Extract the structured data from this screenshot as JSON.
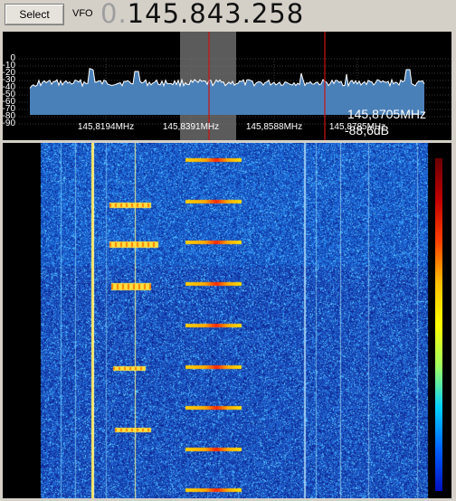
{
  "toolbar": {
    "select_label": "Select",
    "vfo_label": "VFO",
    "vfo_dim_prefix": "0.",
    "vfo_frequency": "145.843.258"
  },
  "spectrum": {
    "db_labels": [
      "0",
      "-10",
      "-20",
      "-30",
      "-40",
      "-50",
      "-60",
      "-70",
      "-80",
      "-90"
    ],
    "freq_labels": [
      "145,8194MHz",
      "145,8391MHz",
      "145,8588MHz",
      "145,8785MHz"
    ],
    "cursor_readout_freq": "145,8705MHz",
    "cursor_readout_level": "-88,6dB",
    "colors": {
      "trace": "#ffffff",
      "fill": "#4a80b8",
      "marker": "#d01010",
      "passband": "#7a7a7a"
    }
  },
  "waterfall": {
    "colorbar_colors": [
      "#6a0000",
      "#c00000",
      "#ff4000",
      "#ffc000",
      "#ffff00",
      "#a0ff60",
      "#00d0ff",
      "#0060ff",
      "#0010c0"
    ]
  }
}
